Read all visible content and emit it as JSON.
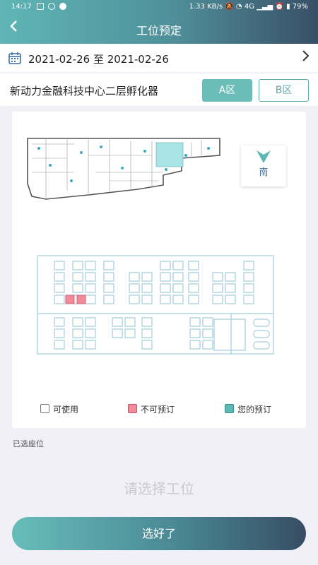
{
  "status_bar": {
    "time": "14:17",
    "speed": "1.33 KB/s",
    "network": "4G",
    "battery": "79%"
  },
  "header": {
    "title": "工位预定",
    "back_icon": "chevron-left-icon"
  },
  "date_range": {
    "text": "2021-02-26 至 2021-02-26",
    "icon": "calendar-icon",
    "next_icon": "chevron-right-icon"
  },
  "location": {
    "name": "新动力金融科技中心二层孵化器",
    "zones": [
      "A区",
      "B区"
    ],
    "active_zone": "A区"
  },
  "compass": {
    "label": "南"
  },
  "legend": {
    "available": "可使用",
    "unavailable": "不可预订",
    "mine": "您的预订"
  },
  "selection": {
    "label": "已选座位",
    "placeholder": "请选择工位"
  },
  "confirm_button": "选好了",
  "colors": {
    "primary": "#6cbcb8",
    "unavailable": "#f28a9a",
    "mine": "#5bb8b3"
  }
}
